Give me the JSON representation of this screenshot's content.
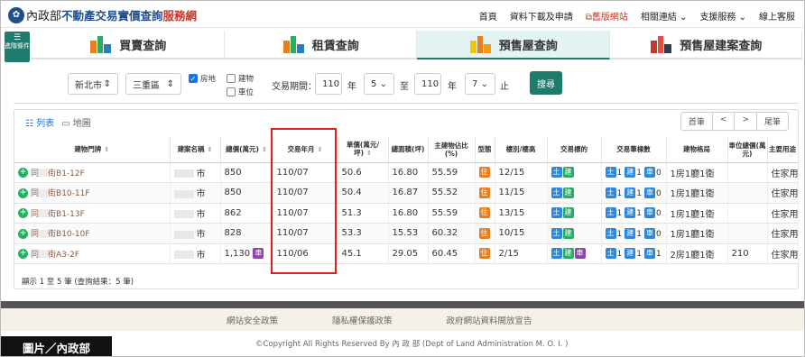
{
  "header": {
    "logo_text": "內政部",
    "site_title": "不動產交易實價查詢",
    "site_suffix": "服務網",
    "nav": [
      "首頁",
      "資料下載及申請",
      "舊版網站",
      "相關連結",
      "支援服務",
      "線上客服"
    ]
  },
  "side_button": "進階條件",
  "tabs": [
    "買賣查詢",
    "租賃查詢",
    "預售屋查詢",
    "預售屋建案查詢"
  ],
  "filters": {
    "city": "新北市",
    "district": "三重區",
    "types": [
      {
        "label": "房地",
        "checked": true
      },
      {
        "label": "建物",
        "checked": false
      },
      {
        "label": "車位",
        "checked": false
      }
    ],
    "period_label": "交易期間：",
    "from_year": "110",
    "from_month": "5",
    "to_year": "110",
    "to_month": "7",
    "year_unit": "年",
    "to_label": "至",
    "end_label": "止",
    "search_label": "搜尋"
  },
  "results": {
    "view_list": "列表",
    "view_map": "地圖",
    "pager": [
      "首筆",
      "<",
      ">",
      "尾筆"
    ],
    "columns": [
      "建物門牌",
      "建案名稱",
      "總價(萬元)",
      "交易年月",
      "單價(萬元/坪)",
      "總面積(坪)",
      "主建物佔比(%)",
      "型態",
      "樓別/樓高",
      "交易標的",
      "交易筆棟數",
      "建物格局",
      "車位總價(萬元)",
      "主要用途"
    ],
    "rows": [
      {
        "addr_prefix": "同",
        "addr": "街B1-12F",
        "project_suffix": "市",
        "total": "850",
        "extra": "",
        "ym": "110/07",
        "unit": "50.6",
        "area": "16.80",
        "ratio": "55.59",
        "type": "住",
        "floor": "12/15",
        "target": [
          "土",
          "建"
        ],
        "count": [
          "1",
          "1",
          "0"
        ],
        "layout": "1房1廳1衛",
        "parking": "",
        "use": "住家用"
      },
      {
        "addr_prefix": "同",
        "addr": "街B10-11F",
        "project_suffix": "市",
        "total": "850",
        "extra": "",
        "ym": "110/07",
        "unit": "50.4",
        "area": "16.87",
        "ratio": "55.52",
        "type": "住",
        "floor": "11/15",
        "target": [
          "土",
          "建"
        ],
        "count": [
          "1",
          "1",
          "0"
        ],
        "layout": "1房1廳1衛",
        "parking": "",
        "use": "住家用"
      },
      {
        "addr_prefix": "同",
        "addr": "街B1-13F",
        "project_suffix": "市",
        "total": "862",
        "extra": "",
        "ym": "110/07",
        "unit": "51.3",
        "area": "16.80",
        "ratio": "55.59",
        "type": "住",
        "floor": "13/15",
        "target": [
          "土",
          "建"
        ],
        "count": [
          "1",
          "1",
          "0"
        ],
        "layout": "1房1廳1衛",
        "parking": "",
        "use": "住家用"
      },
      {
        "addr_prefix": "同",
        "addr": "街B10-10F",
        "project_suffix": "市",
        "total": "828",
        "extra": "",
        "ym": "110/07",
        "unit": "53.3",
        "area": "15.53",
        "ratio": "60.32",
        "type": "住",
        "floor": "10/15",
        "target": [
          "土",
          "建"
        ],
        "count": [
          "1",
          "1",
          "0"
        ],
        "layout": "1房1廳1衛",
        "parking": "",
        "use": "住家用"
      },
      {
        "addr_prefix": "同",
        "addr": "街A3-2F",
        "project_suffix": "市",
        "total": "1,130",
        "extra": "車",
        "ym": "110/06",
        "unit": "45.1",
        "area": "29.05",
        "ratio": "60.45",
        "type": "住",
        "floor": "2/15",
        "target": [
          "土",
          "建",
          "車"
        ],
        "count": [
          "1",
          "1",
          "1"
        ],
        "layout": "2房1廳1衛",
        "parking": "210",
        "use": "住家用"
      }
    ],
    "summary": "顯示 1 至 5 筆 (查詢結果：5 筆)"
  },
  "footer": {
    "links": [
      "網站安全政策",
      "隱私權保護政策",
      "政府網站資料開放宣告"
    ],
    "copyright": "©Copyright All Rights Reserved By 內 政 部 (Dept of Land Administration M. O. I. )"
  },
  "credit": "圖片／內政部",
  "colors": {
    "accent": "#1e7b6e",
    "brand": "#1f4e8c",
    "highlight": "#e02020"
  }
}
